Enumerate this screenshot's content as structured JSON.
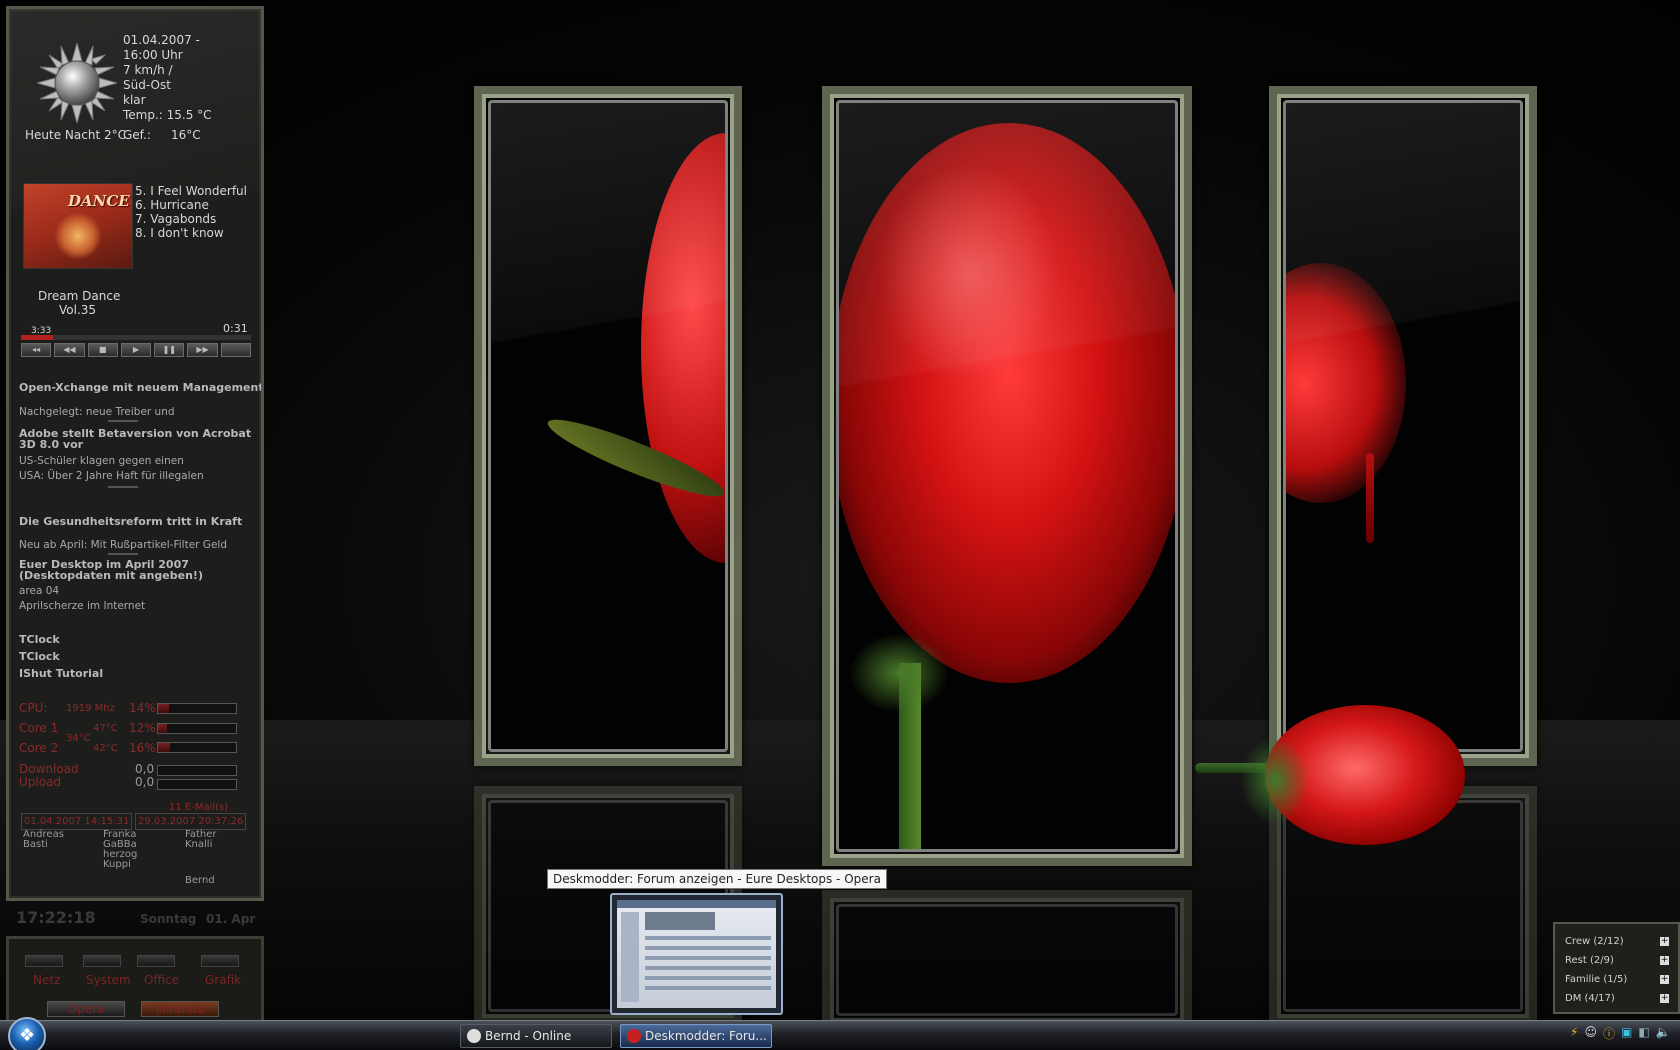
{
  "weather": {
    "date": "01.04.2007 -",
    "time": "16:00 Uhr",
    "wind": "7 km/h /",
    "direction": "Süd-Ost",
    "condition": "klar",
    "temp": "Temp.: 15.5 °C",
    "tonight": "Heute Nacht 2°C",
    "felt_label": "Gef.:",
    "felt_value": "16°C"
  },
  "player": {
    "tracks": [
      "5. I Feel Wonderful",
      "6. Hurricane",
      "7. Vagabonds",
      "8. I don't know"
    ],
    "album_line1": "Dream Dance",
    "album_line2": "Vol.35",
    "album_cover_text": "DANCE",
    "elapsed": "3:33",
    "remaining": "0:31",
    "progress": 0.14
  },
  "news": [
    {
      "text": "Open-Xchange mit neuem Management",
      "bold": true
    },
    {
      "text": "Nachgelegt: neue Treiber und",
      "bold": false
    },
    {
      "text": "Adobe stellt Betaversion von Acrobat 3D 8.0 vor",
      "bold": true
    },
    {
      "text": "US-Schüler klagen gegen einen",
      "bold": false
    },
    {
      "text": "USA: Über 2 Jahre Haft für illegalen",
      "bold": false
    },
    {
      "text": "Die Gesundheitsreform tritt in Kraft",
      "bold": true
    },
    {
      "text": "Neu ab April: Mit Rußpartikel-Filter Geld",
      "bold": false
    },
    {
      "text": "Euer Desktop im April 2007 (Desktopdaten mit angeben!)",
      "bold": true
    },
    {
      "text": "area 04",
      "bold": false
    },
    {
      "text": "Aprilscherze im Internet",
      "bold": false
    },
    {
      "text": "TClock",
      "bold": true
    },
    {
      "text": "TClock",
      "bold": true
    },
    {
      "text": "IShut Tutorial",
      "bold": true
    }
  ],
  "system": {
    "cpu_label": "CPU:",
    "cpu_mhz": "1919 Mhz",
    "cpu_pct": "14%",
    "cpu_level": 0.14,
    "core1_label": "Core 1",
    "core1_temp": "47°C",
    "core1_pct": "12%",
    "core1_level": 0.12,
    "core2_label": "Core 2",
    "core2_temp": "42°C",
    "core2_pct": "16%",
    "core2_level": 0.16,
    "board_temp": "34°C",
    "download_label": "Download",
    "download_val": "0,0",
    "upload_label": "Upload",
    "upload_val": "0,0"
  },
  "mail": {
    "count": "11 E-Mail(s)",
    "time1": "01.04.2007 14:15:31",
    "time2": "29.03.2007 20:37:26"
  },
  "contacts_col1": [
    "Andreas",
    "Basti"
  ],
  "contacts_col2": [
    "Franka",
    "GaBBa",
    "herzog",
    "Kuppi"
  ],
  "contacts_col3": [
    "Father",
    "Knalli"
  ],
  "contacts_user": "Bernd",
  "clock": {
    "time": "17:22:18",
    "day": "Sonntag",
    "date": "01. Apr"
  },
  "launcher": {
    "items": [
      "Netz",
      "System",
      "Office",
      "Grafik"
    ],
    "big_items": [
      "Opera",
      "Miranda"
    ]
  },
  "tooltip": "Deskmodder: Forum anzeigen - Eure Desktops - Opera",
  "taskbar": {
    "tasks": [
      {
        "label": "Bernd - Online",
        "icon": "miranda-icon"
      },
      {
        "label": "Deskmodder: Foru...",
        "icon": "opera-icon"
      }
    ]
  },
  "contact_groups": [
    {
      "label": "Crew (2/12)"
    },
    {
      "label": "Rest (2/9)"
    },
    {
      "label": "Familie (1/5)"
    },
    {
      "label": "DM (4/17)"
    }
  ],
  "colors": {
    "accent_red": "#b02020",
    "panel_frame": "#5e6550",
    "taskbar": "#1e2026"
  }
}
